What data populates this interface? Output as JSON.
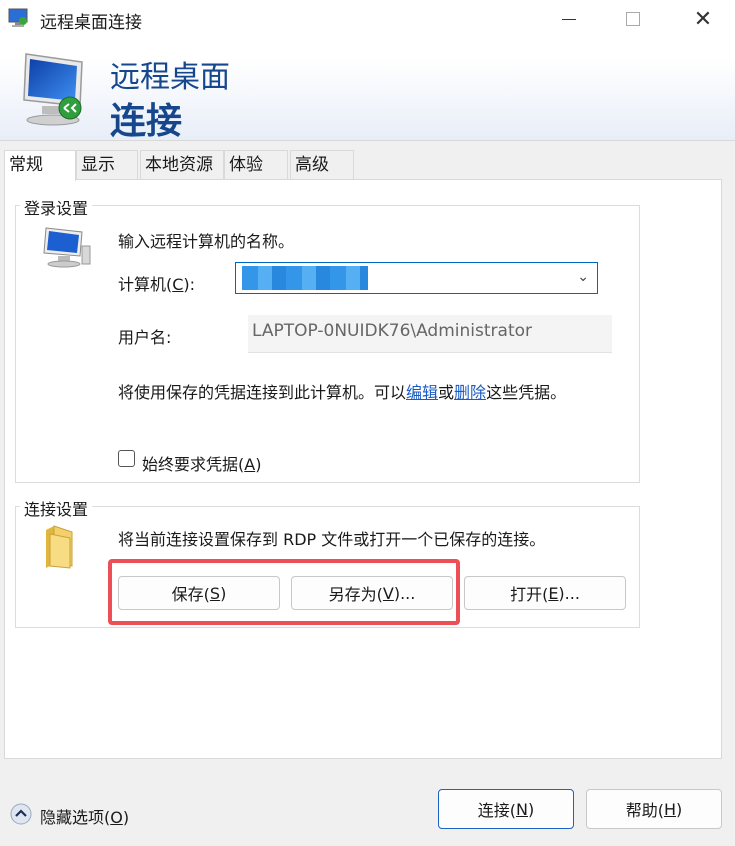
{
  "window": {
    "title": "远程桌面连接",
    "min_icon": "minimize-icon",
    "max_icon": "maximize-icon",
    "close_glyph": "✕"
  },
  "banner": {
    "line1": "远程桌面",
    "line2": "连接",
    "icon": "remote-desktop-monitor-icon"
  },
  "tabs": [
    {
      "label": "常规",
      "active": true
    },
    {
      "label": "显示",
      "active": false
    },
    {
      "label": "本地资源",
      "active": false
    },
    {
      "label": "体验",
      "active": false
    },
    {
      "label": "高级",
      "active": false
    }
  ],
  "login_settings": {
    "label": "登录设置",
    "instruction": "输入远程计算机的名称。",
    "computer_label_pre": "计算机(",
    "computer_label_key": "C",
    "computer_label_post": "):",
    "computer_value": "",
    "username_label": "用户名:",
    "username_value": "LAPTOP-0NUIDK76\\Administrator",
    "credentials_pre": "将使用保存的凭据连接到此计算机。可以",
    "edit_link": "编辑",
    "or_text": "或",
    "delete_link": "删除",
    "credentials_post": "这些凭据。",
    "always_ask_pre": "始终要求凭据(",
    "always_ask_key": "A",
    "always_ask_post": ")",
    "always_ask_checked": false
  },
  "connection_settings": {
    "label": "连接设置",
    "description": "将当前连接设置保存到 RDP 文件或打开一个已保存的连接。",
    "save_pre": "保存(",
    "save_key": "S",
    "save_post": ")",
    "save_as_pre": "另存为(",
    "save_as_key": "V",
    "save_as_post": ")...",
    "open_pre": "打开(",
    "open_key": "E",
    "open_post": ")..."
  },
  "footer": {
    "hide_options_pre": "隐藏选项(",
    "hide_options_key": "O",
    "hide_options_post": ")",
    "connect_pre": "连接(",
    "connect_key": "N",
    "connect_post": ")",
    "help_pre": "帮助(",
    "help_key": "H",
    "help_post": ")"
  },
  "colors": {
    "accent": "#16468c",
    "link": "#1a5bc4",
    "highlight": "#ec4f55"
  }
}
